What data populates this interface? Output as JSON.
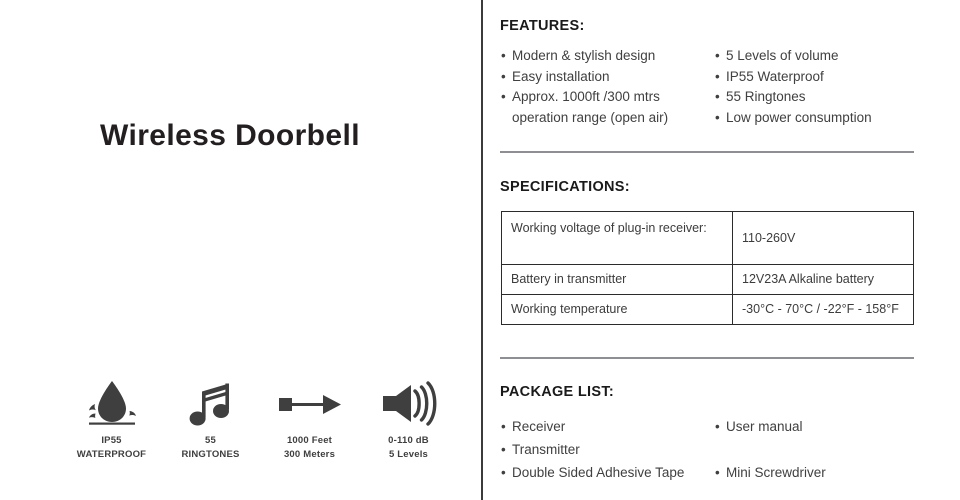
{
  "product": {
    "title": "Wireless Doorbell"
  },
  "badges": [
    {
      "icon": "water-drop-icon",
      "line1": "IP55",
      "line2": "WATERPROOF"
    },
    {
      "icon": "music-note-icon",
      "line1": "55",
      "line2": "RINGTONES"
    },
    {
      "icon": "arrow-range-icon",
      "line1": "1000 Feet",
      "line2": "300 Meters"
    },
    {
      "icon": "speaker-volume-icon",
      "line1": "0-110 dB",
      "line2": "5 Levels"
    }
  ],
  "features": {
    "heading": "FEATURES:",
    "column_left": [
      {
        "text": "Modern & stylish design",
        "continuation": false
      },
      {
        "text": "Easy installation",
        "continuation": false
      },
      {
        "text": "Approx. 1000ft /300 mtrs",
        "continuation": false
      },
      {
        "text": "operation range (open air)",
        "continuation": true
      }
    ],
    "column_right": [
      {
        "text": "5 Levels of volume",
        "continuation": false
      },
      {
        "text": "IP55 Waterproof",
        "continuation": false
      },
      {
        "text": "55 Ringtones",
        "continuation": false
      },
      {
        "text": "Low power consumption",
        "continuation": false
      }
    ]
  },
  "specifications": {
    "heading": "SPECIFICATIONS:",
    "rows": [
      {
        "label": "Working voltage of plug-in receiver:",
        "value": "110-260V"
      },
      {
        "label": "Battery in transmitter",
        "value": "12V23A Alkaline battery"
      },
      {
        "label": "Working temperature",
        "value": "-30°C - 70°C / -22°F - 158°F"
      }
    ]
  },
  "package_list": {
    "heading": "PACKAGE LIST:",
    "column_left": [
      "Receiver",
      "Transmitter",
      "Double Sided Adhesive Tape"
    ],
    "column_right": [
      "User manual",
      "Mini Screwdriver"
    ]
  },
  "colors": {
    "text_dark": "#1a1a1a",
    "text_body": "#404040",
    "icon_fill": "#3f3f3f",
    "divider": "#8d8f92",
    "table_border": "#2b2b2b"
  }
}
